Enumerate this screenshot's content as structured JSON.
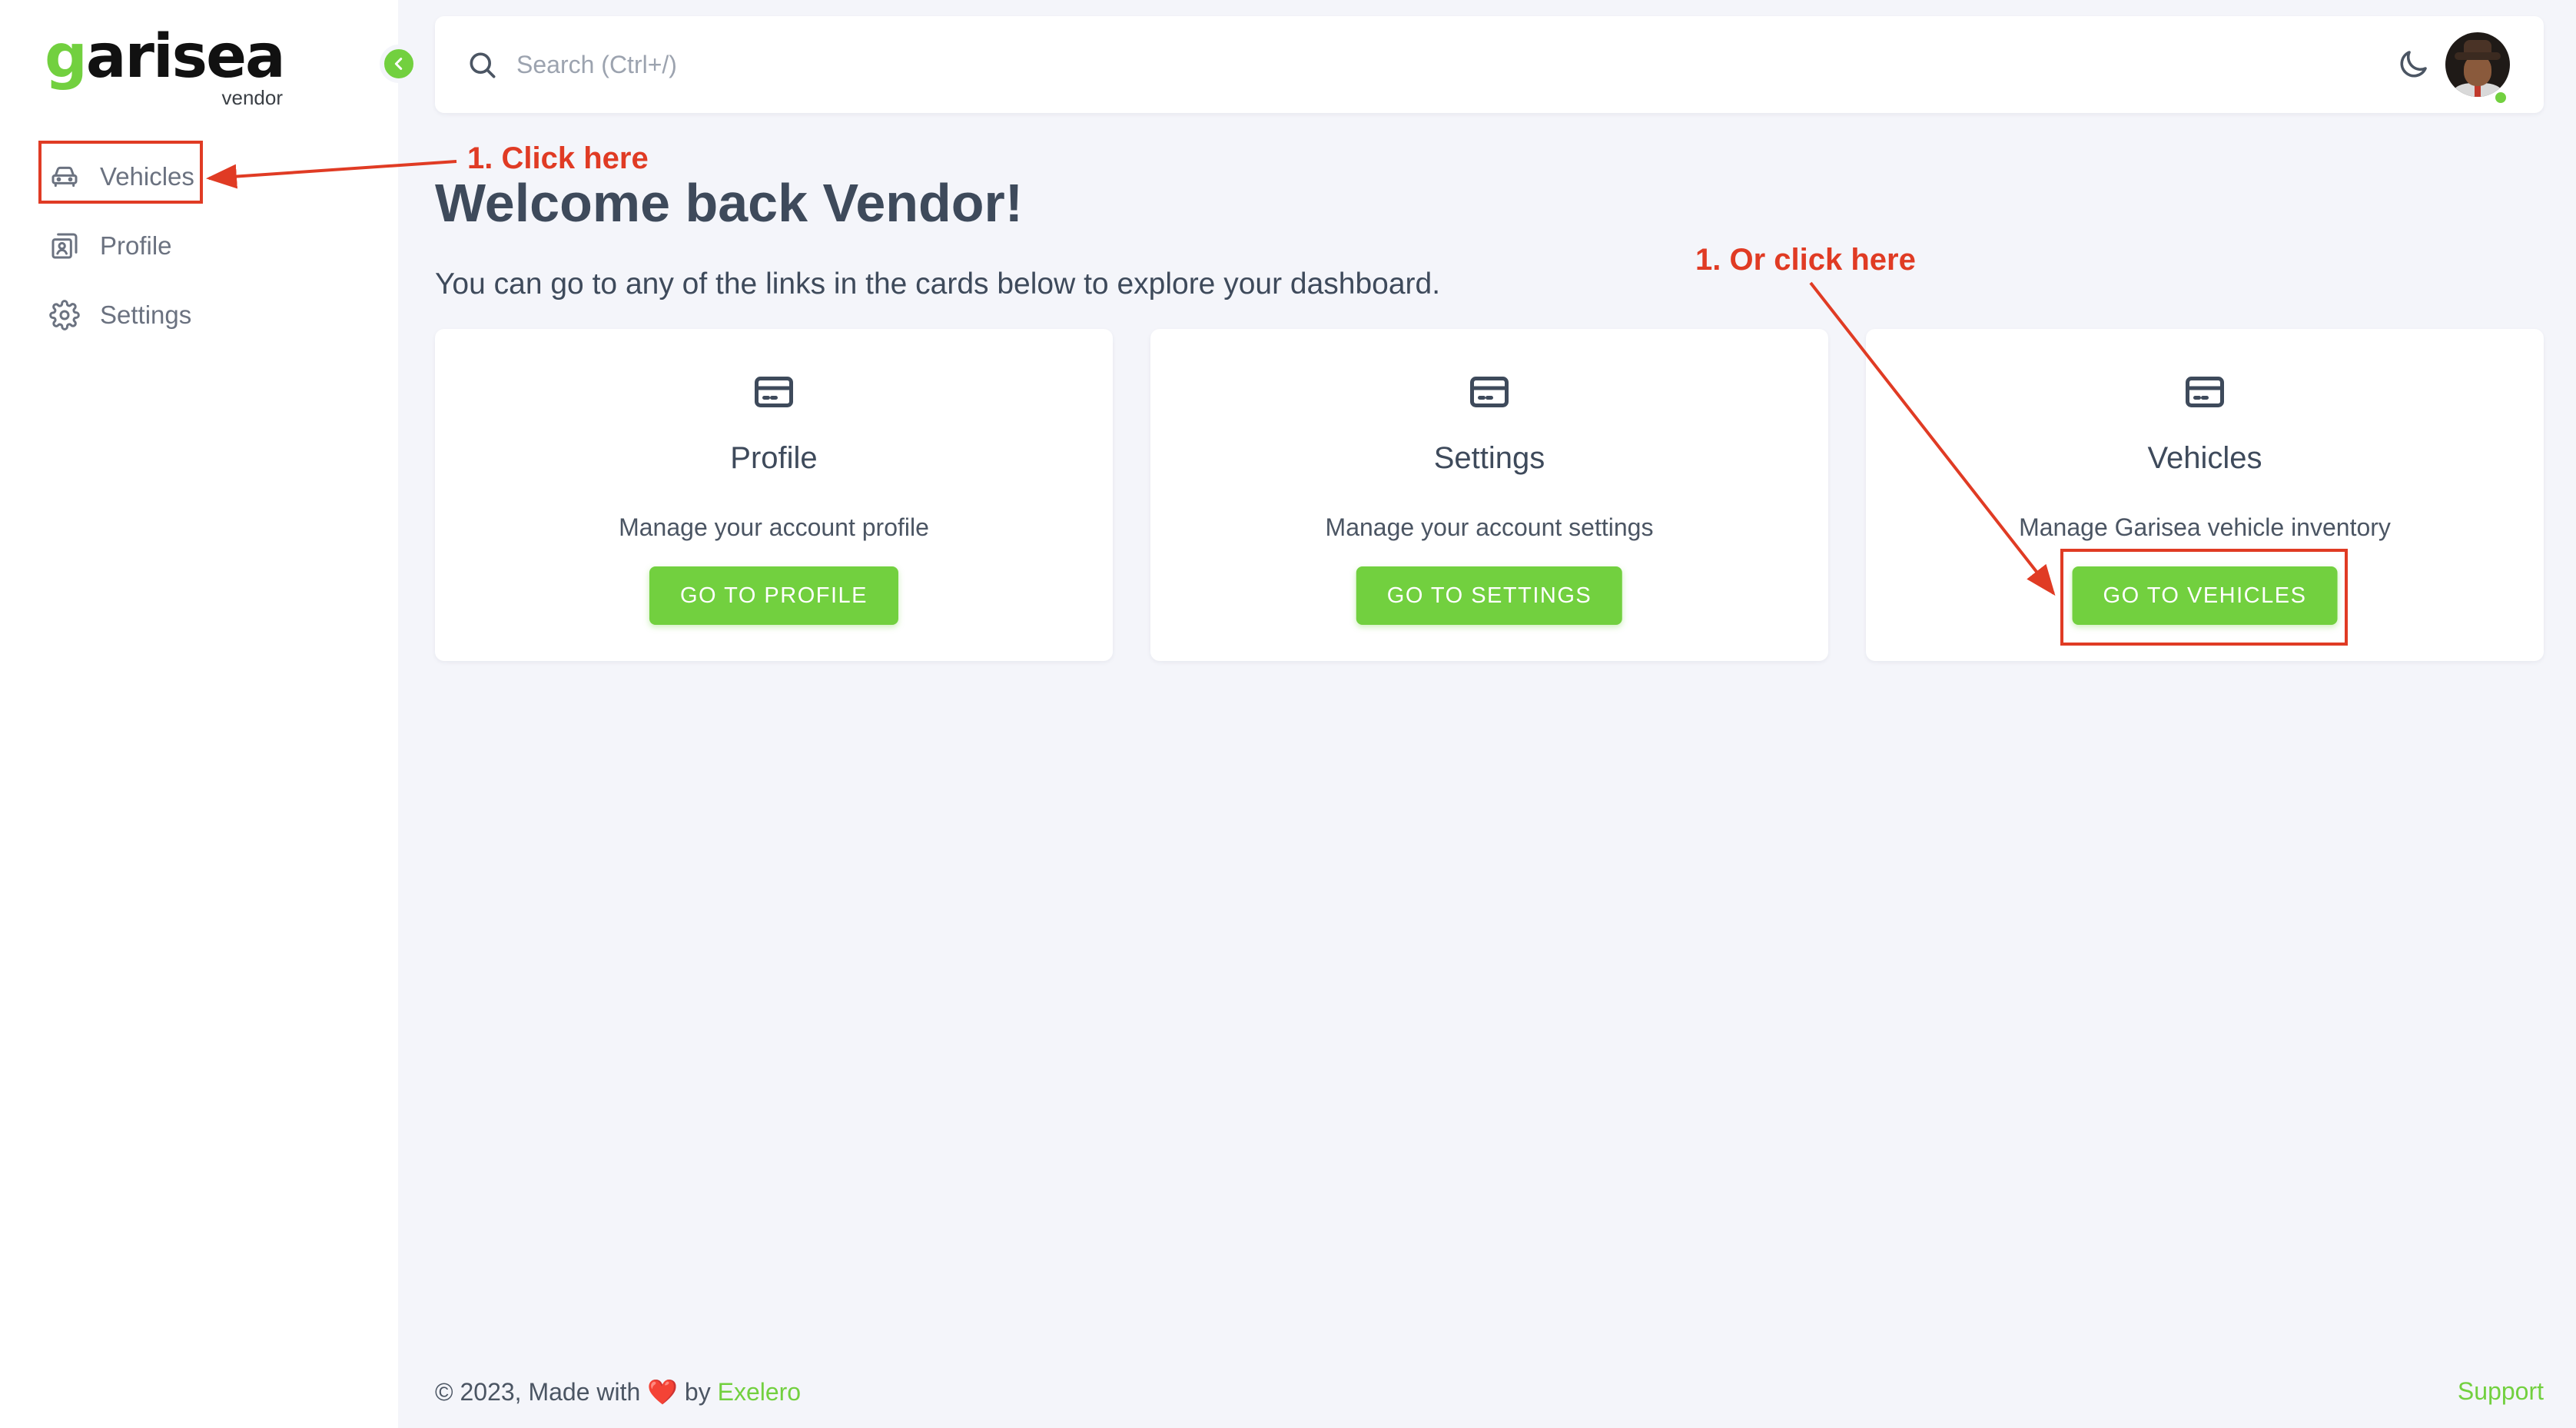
{
  "brand": {
    "logo_first": "g",
    "logo_rest": "arisea",
    "subtitle": "vendor",
    "accent_color": "#72d03f"
  },
  "sidebar": {
    "collapse_icon": "chevron-left-icon",
    "items": [
      {
        "label": "Vehicles",
        "icon": "car-icon"
      },
      {
        "label": "Profile",
        "icon": "contact-card-icon"
      },
      {
        "label": "Settings",
        "icon": "gear-icon"
      }
    ]
  },
  "topbar": {
    "search_placeholder": "Search (Ctrl+/)",
    "search_icon": "search-icon",
    "theme_icon": "moon-icon",
    "avatar_icon": "user-avatar"
  },
  "main": {
    "welcome": "Welcome back Vendor!",
    "subtitle": "You can go to any of the links in the cards below to explore your dashboard.",
    "cards": [
      {
        "icon": "credit-card-icon",
        "title": "Profile",
        "description": "Manage your account profile",
        "button": "GO TO PROFILE"
      },
      {
        "icon": "credit-card-icon",
        "title": "Settings",
        "description": "Manage your account settings",
        "button": "GO TO SETTINGS"
      },
      {
        "icon": "credit-card-icon",
        "title": "Vehicles",
        "description": "Manage Garisea vehicle inventory",
        "button": "GO TO VEHICLES"
      }
    ]
  },
  "footer": {
    "prefix": "© 2023, Made with",
    "heart": "❤️",
    "by": "by",
    "company": "Exelero",
    "support": "Support"
  },
  "annotations": {
    "click_here": "1. Click here",
    "or_click_here": "1. Or click here",
    "color": "#e03b24"
  }
}
